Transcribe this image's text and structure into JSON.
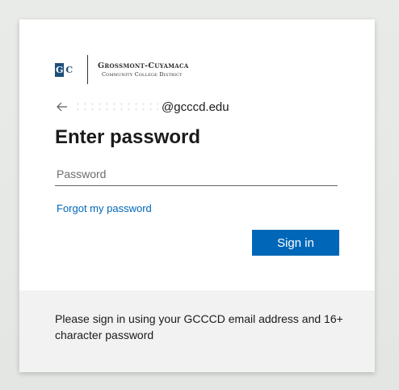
{
  "branding": {
    "logo_letters": [
      "G",
      "C"
    ],
    "org_name": "Grossmont-Cuyamaca",
    "org_subtitle": "Community College District"
  },
  "identity": {
    "back_icon": "arrow-left-icon",
    "email_domain": "@gcccd.edu"
  },
  "form": {
    "title": "Enter password",
    "password_placeholder": "Password",
    "forgot_link": "Forgot my password",
    "signin_label": "Sign in"
  },
  "footer": {
    "message": "Please sign in using your GCCCD email address and 16+ character password"
  },
  "colors": {
    "accent": "#0067b8",
    "logo_blue": "#1f4e79",
    "footer_bg": "#f2f2f2"
  }
}
